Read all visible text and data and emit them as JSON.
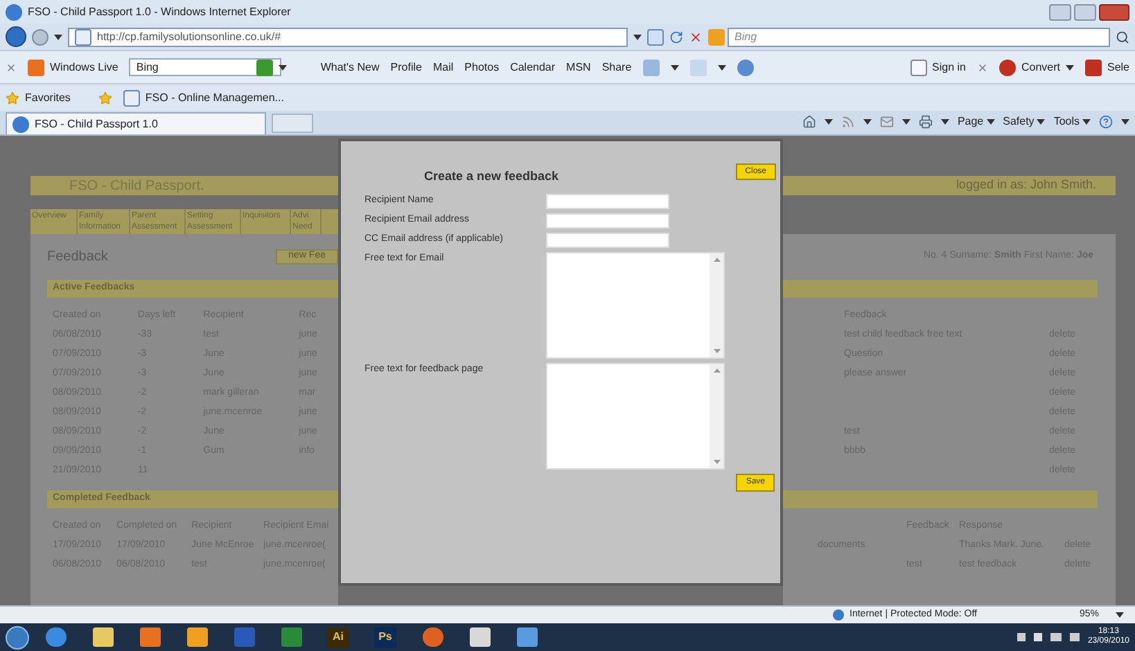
{
  "window": {
    "title": "FSO - Child Passport 1.0 - Windows Internet Explorer"
  },
  "address_bar": {
    "url": "http://cp.familysolutionsonline.co.uk/#",
    "search_placeholder": "Bing"
  },
  "toolbar": {
    "brand": "Windows Live",
    "search_value": "Bing",
    "links": [
      "What's New",
      "Profile",
      "Mail",
      "Photos",
      "Calendar",
      "MSN",
      "Share"
    ],
    "sign_in": "Sign in",
    "convert": "Convert",
    "select": "Sele"
  },
  "favorites_bar": {
    "favorites": "Favorites",
    "items": [
      "FSO - Online Managemen..."
    ]
  },
  "tabs": [
    {
      "label": "FSO - Child Passport 1.0",
      "selected": true
    }
  ],
  "command_bar": [
    "Page",
    "Safety",
    "Tools"
  ],
  "page": {
    "site_title": "FSO - Child Passport.",
    "logged_in": "logged in as: John Smith.",
    "nav": [
      "Overview",
      "Family Information",
      "Parent Assessment",
      "Setting Assessment",
      "Inquisitors",
      "Advi Need"
    ],
    "heading": "Feedback",
    "new_button": "new Fee",
    "child_info": "No. 4  Surname: **Smith**  First Name: **Joe**",
    "active": {
      "title": "Active Feedbacks",
      "columns": [
        "Created on",
        "Days left",
        "Recipient",
        "Rec",
        "Feedback"
      ],
      "rows": [
        {
          "created": "06/08/2010",
          "days_left": "-33",
          "recipient": "test",
          "recipient_email": "june",
          "feedback": "test child feedback free text",
          "action": "delete"
        },
        {
          "created": "07/09/2010",
          "days_left": "-3",
          "recipient": "June",
          "recipient_email": "june",
          "feedback": "Question",
          "action": "delete"
        },
        {
          "created": "07/09/2010",
          "days_left": "-3",
          "recipient": "June",
          "recipient_email": "june",
          "feedback": "please answer",
          "action": "delete"
        },
        {
          "created": "08/09/2010",
          "days_left": "-2",
          "recipient": "mark gilleran",
          "recipient_email": "mar",
          "action": "delete"
        },
        {
          "created": "08/09/2010",
          "days_left": "-2",
          "recipient": "june.mcenroe",
          "recipient_email": "june",
          "action": "delete"
        },
        {
          "created": "08/09/2010",
          "days_left": "-2",
          "recipient": "June",
          "recipient_email": "june",
          "feedback": "test",
          "action": "delete"
        },
        {
          "created": "09/09/2010",
          "days_left": "-1",
          "recipient": "Gum",
          "recipient_email": "info",
          "feedback": "bbbb",
          "action": "delete"
        },
        {
          "created": "21/09/2010",
          "days_left": "11",
          "action": "delete"
        }
      ]
    },
    "completed": {
      "title": "Completed Feedback",
      "columns": [
        "Created on",
        "Completed on",
        "Recipient",
        "Recipient Emai",
        "Feedback",
        "Response"
      ],
      "rows": [
        {
          "created": "17/09/2010",
          "completed": "17/09/2010",
          "recipient": "June McEnroe",
          "recipient_email": "june.mcenroe(",
          "column_5": "documents",
          "response": "Thanks Mark. June.",
          "action": "delete"
        },
        {
          "created": "06/08/2010",
          "completed": "06/08/2010",
          "recipient": "test",
          "recipient_email": "june.mcenroe(",
          "feedback": "test",
          "response": "test feedback",
          "action": "delete"
        }
      ]
    }
  },
  "dialog": {
    "title": "Create a new feedback",
    "close": "Close",
    "save": "Save",
    "fields": [
      {
        "kind": "input",
        "label": "Recipient Name"
      },
      {
        "kind": "input",
        "label": "Recipient Email address"
      },
      {
        "kind": "input",
        "label": "CC Email address (if applicable)"
      },
      {
        "kind": "textarea",
        "label": "Free text for Email"
      },
      {
        "kind": "textarea",
        "label": "Free text for feedback page"
      }
    ]
  },
  "status_bar": {
    "zone": "Internet | Protected Mode: Off",
    "zoom": "95%"
  },
  "taskbar": {
    "apps": [
      {
        "kind": "ie"
      },
      {
        "kind": "folder"
      },
      {
        "kind": "media"
      },
      {
        "kind": "outlook"
      },
      {
        "kind": "word"
      },
      {
        "kind": "excel"
      },
      {
        "kind": "letters",
        "label": "Ai",
        "color": "#3a2a0a"
      },
      {
        "kind": "letters",
        "label": "Ps",
        "color": "#0a2a5a"
      },
      {
        "kind": "firefox"
      },
      {
        "kind": "drive"
      },
      {
        "kind": "window"
      }
    ],
    "time": "18:13",
    "date": "23/09/2010"
  }
}
